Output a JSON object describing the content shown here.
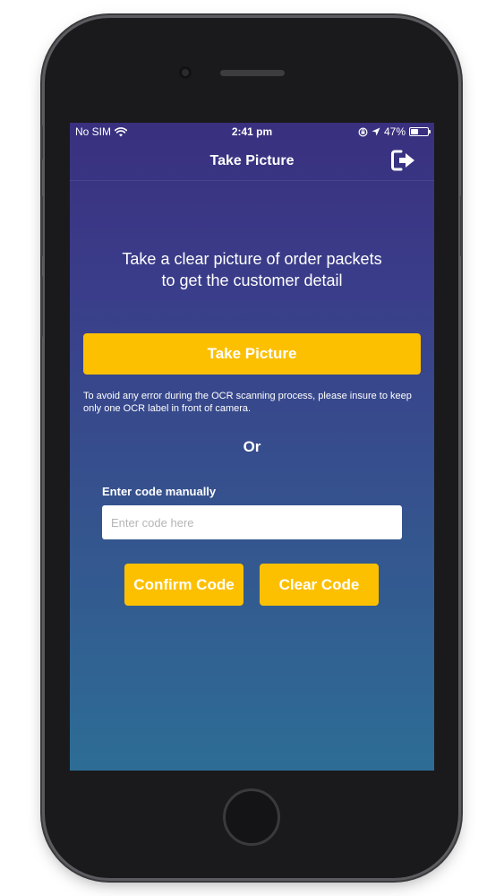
{
  "status_bar": {
    "carrier": "No SIM",
    "time": "2:41 pm",
    "battery_percent": "47%",
    "battery_level": 0.47
  },
  "nav": {
    "title": "Take Picture",
    "logout_icon": "logout-icon"
  },
  "main": {
    "headline_line1": "Take a clear picture of order packets",
    "headline_line2": "to get the customer detail",
    "take_picture_label": "Take Picture",
    "note": "To avoid any error during the OCR scanning process, please insure to keep only one OCR label in front of camera.",
    "or_label": "Or",
    "manual_label": "Enter code manually",
    "code_input": {
      "value": "",
      "placeholder": "Enter code here"
    },
    "confirm_label": "Confirm Code",
    "clear_label": "Clear Code"
  },
  "colors": {
    "accent": "#fdc000",
    "gradient_top": "#39307f",
    "gradient_bottom": "#2d6d95"
  }
}
